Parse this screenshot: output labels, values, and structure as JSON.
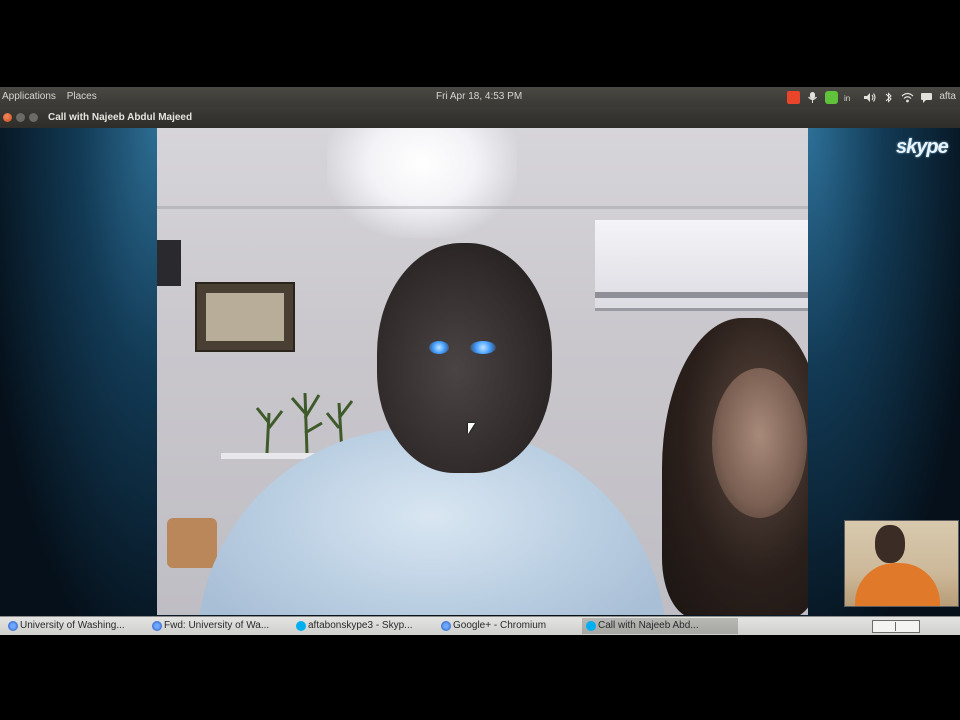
{
  "top_panel": {
    "menu_applications": "Applications",
    "menu_places": "Places",
    "clock": "Fri Apr 18, 4:53 PM",
    "user": "afta",
    "tray_icons": [
      "stop-icon",
      "mic-icon",
      "skype-tray-icon",
      "network-speed-icon",
      "volume-icon",
      "bluetooth-icon",
      "wifi-icon",
      "chat-icon"
    ]
  },
  "window": {
    "title": "Call with Najeeb Abdul Majeed"
  },
  "call": {
    "brand": "skype"
  },
  "taskbar": {
    "tasks": [
      {
        "label": "University of Washing...",
        "icon": "chromium-icon",
        "active": false
      },
      {
        "label": "Fwd: University of Wa...",
        "icon": "chromium-icon",
        "active": false
      },
      {
        "label": "aftabonskype3 - Skyp...",
        "icon": "skype-icon",
        "active": false
      },
      {
        "label": "Google+ - Chromium",
        "icon": "chromium-icon",
        "active": false
      },
      {
        "label": "Call with Najeeb Abd...",
        "icon": "skype-icon",
        "active": true
      }
    ]
  },
  "colors": {
    "panel": "#3c3b37",
    "skype_blue": "#00aff0",
    "close_button": "#df4a16",
    "taskbar": "#dcdcda"
  }
}
